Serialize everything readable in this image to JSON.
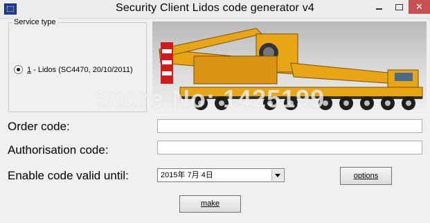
{
  "window": {
    "title": "Security Client Lidos code generator v4",
    "controls": {
      "minimize": "—",
      "maximize": "□",
      "close": "✕"
    }
  },
  "service_type": {
    "legend": "Service type",
    "option_number": "1",
    "option_text": "- Lidos (SC4470, 20/10/2011)",
    "selected": true
  },
  "image": {
    "description_icon": "crane-truck-photo"
  },
  "watermark": "Store No: 1425199",
  "form": {
    "order_code_label": "Order code:",
    "order_code_value": "",
    "authorisation_code_label": "Authorisation code:",
    "authorisation_code_value": "",
    "valid_until_label": "Enable code valid until:",
    "valid_until_value": "2015年  7月  4日"
  },
  "buttons": {
    "options": "options",
    "make": "make"
  },
  "colors": {
    "window_bg": "#f0f0f0",
    "crane_yellow": "#e8a516",
    "close_red": "#c75050"
  }
}
